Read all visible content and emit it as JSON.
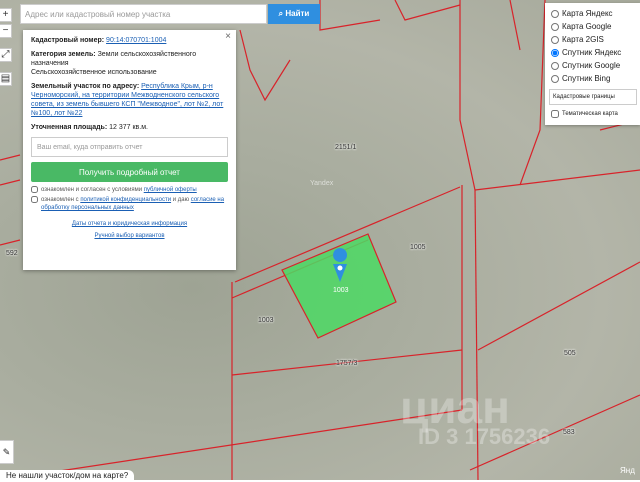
{
  "search": {
    "placeholder": "Адрес или кадастровый номер участка",
    "button_label": "Найти"
  },
  "toolbar": {
    "zoom_in": "+",
    "zoom_out": "−"
  },
  "info": {
    "cadastral_label": "Кадастровый номер:",
    "cadastral_number": "90:14:070701:1004",
    "category_label": "Категория земель:",
    "category_value": "Земли сельскохозяйственного назначения",
    "usage_value": "Сельскохозяйственное использование",
    "address_label": "Земельный участок по адресу:",
    "address_value": "Республика Крым, р-н Черноморский, на территории Межводненского сельского совета, из земель бывшего КСП \"Межводное\", лот №2, лот №100, лот №22",
    "area_label": "Уточненная площадь:",
    "area_value": "12 377 кв.м.",
    "email_placeholder": "Ваш email, куда отправить отчет",
    "report_button": "Получить подробный отчет",
    "agree1_text": "ознакомлен и согласен с условиями ",
    "agree1_link": "публичной оферты",
    "agree2_text": "ознакомлен с ",
    "agree2_link": "политикой конфиденциальности",
    "agree2_mid": " и даю ",
    "agree2_link2": "согласие на обработку персональных данных",
    "report_dates_link": "Даты отчета и юридическая информация",
    "manual_link": "Ручной выбор вариантов",
    "close": "×"
  },
  "layers": {
    "options": [
      {
        "label": "Карта Яндекс",
        "checked": false
      },
      {
        "label": "Карта Google",
        "checked": false
      },
      {
        "label": "Карта 2GIS",
        "checked": false
      },
      {
        "label": "Спутник Яндекс",
        "checked": true
      },
      {
        "label": "Спутник Google",
        "checked": false
      },
      {
        "label": "Спутник Bing",
        "checked": false
      }
    ],
    "overlay_select": "Кадастровые границы",
    "thematic_label": "Тематическая карта"
  },
  "map": {
    "parcel_labels": {
      "p2151": "2151/1",
      "p1005": "1005",
      "p1003": "1003",
      "p1757": "1757/3",
      "p505": "505",
      "p583": "583",
      "p592": "592"
    },
    "selected_parcel_label": "1003",
    "yandex_watermark": "Yandex",
    "cian_watermark": "циан",
    "cian_id": "ID 3 1756236",
    "colors": {
      "boundary": "#d8232a",
      "selected_fill": "#4cd964",
      "pin": "#2f8fe0"
    }
  },
  "bottom": {
    "not_found": "Не нашли участок/дом на карте?",
    "yandex_footer": "Янд"
  }
}
